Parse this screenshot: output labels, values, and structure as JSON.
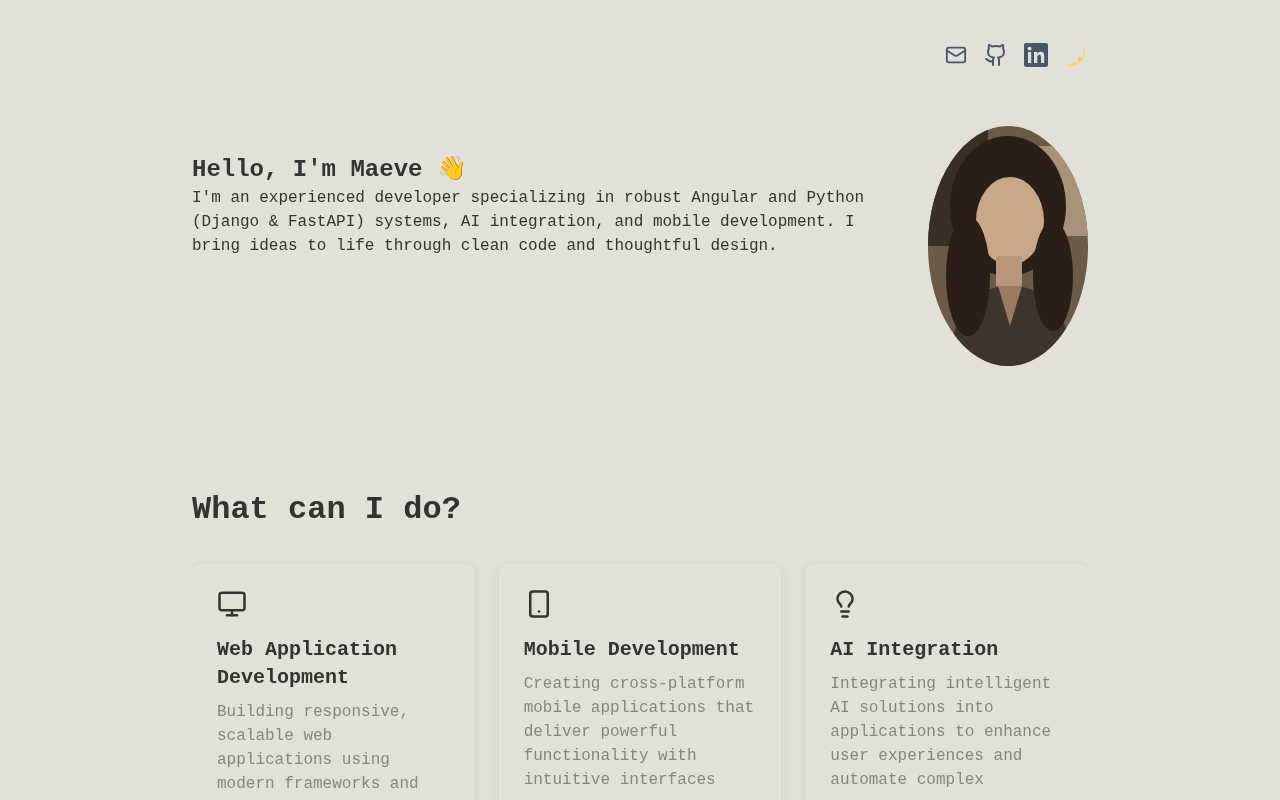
{
  "header": {
    "links": [
      {
        "kind": "mail"
      },
      {
        "kind": "github"
      },
      {
        "kind": "linkedin"
      },
      {
        "kind": "theme"
      }
    ]
  },
  "hero": {
    "title": "Hello, I'm Maeve 👋",
    "bio": "I'm an experienced developer specializing in robust Angular and Python (Django & FastAPI) systems, AI integration, and mobile development. I bring ideas to life through clean code and thoughtful design."
  },
  "services": {
    "title": "What can I do?",
    "cards": [
      {
        "kind": "monitor",
        "title": "Web Application Development",
        "description": "Building responsive, scalable web applications using modern frameworks and"
      },
      {
        "kind": "phone",
        "title": "Mobile Development",
        "description": "Creating cross-platform mobile applications that deliver powerful functionality with intuitive interfaces"
      },
      {
        "kind": "bulb",
        "title": "AI Integration",
        "description": "Integrating intelligent AI solutions into applications to enhance user experiences and automate complex"
      }
    ]
  }
}
